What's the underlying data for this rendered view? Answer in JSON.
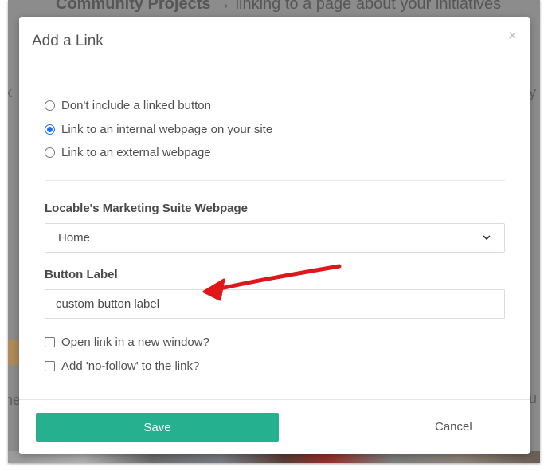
{
  "background": {
    "heading_bold": "Community Projects",
    "heading_rest": " → linking to a page about your initiatives",
    "fragment_left_1": "k",
    "fragment_right_1": "y",
    "fragment_left_2": "ne",
    "fragment_right_2": "u"
  },
  "dialog": {
    "title": "Add a Link",
    "close_glyph": "×",
    "link_options": [
      {
        "label": "Don't include a linked button",
        "checked": false
      },
      {
        "label": "Link to an internal webpage on your site",
        "checked": true
      },
      {
        "label": "Link to an external webpage",
        "checked": false
      }
    ],
    "webpage_field": {
      "label": "Locable's Marketing Suite Webpage",
      "selected": "Home"
    },
    "button_label_field": {
      "label": "Button Label",
      "value": "custom button label"
    },
    "checkboxes": [
      {
        "label": "Open link in a new window?",
        "checked": false
      },
      {
        "label": "Add 'no-follow' to the link?",
        "checked": false
      }
    ],
    "save_label": "Save",
    "cancel_label": "Cancel"
  },
  "colors": {
    "save_button": "#25b08f",
    "radio_selected": "#1a73e8",
    "annotation_arrow": "#e0161b"
  },
  "icons": {
    "close": "close-icon",
    "select": "chevron-down-icon",
    "annotation": "red-arrow-icon"
  }
}
